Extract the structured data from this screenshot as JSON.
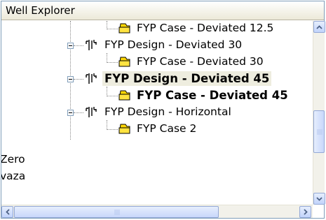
{
  "window": {
    "title": "Well Explorer"
  },
  "tree": {
    "items": [
      {
        "label": "FYP Case - Deviated 12.5",
        "type": "case",
        "bold": false
      },
      {
        "label": "FYP Design - Deviated 30",
        "type": "design",
        "bold": false
      },
      {
        "label": "FYP Case - Deviated 30",
        "type": "case",
        "bold": false
      },
      {
        "label": "FYP Design - Deviated 45",
        "type": "design",
        "bold": true,
        "selected": true
      },
      {
        "label": "FYP Case - Deviated 45",
        "type": "case",
        "bold": true
      },
      {
        "label": "FYP Design - Horizontal",
        "type": "design",
        "bold": false
      },
      {
        "label": "FYP Case 2",
        "type": "case",
        "bold": false
      },
      {
        "label": "Zero",
        "type": "root",
        "bold": false
      },
      {
        "label": "vaza",
        "type": "root",
        "bold": false
      }
    ]
  },
  "scrollbar": {
    "vertical": {
      "up_icon": "arrow-up-icon",
      "down_icon": "arrow-down-icon"
    },
    "horizontal": {
      "left_icon": "arrow-left-icon",
      "right_icon": "arrow-right-icon"
    }
  },
  "colors": {
    "selected_background": "#eeeddf",
    "border": "#7f9db9",
    "scroll_button": "#c1d3fb"
  }
}
